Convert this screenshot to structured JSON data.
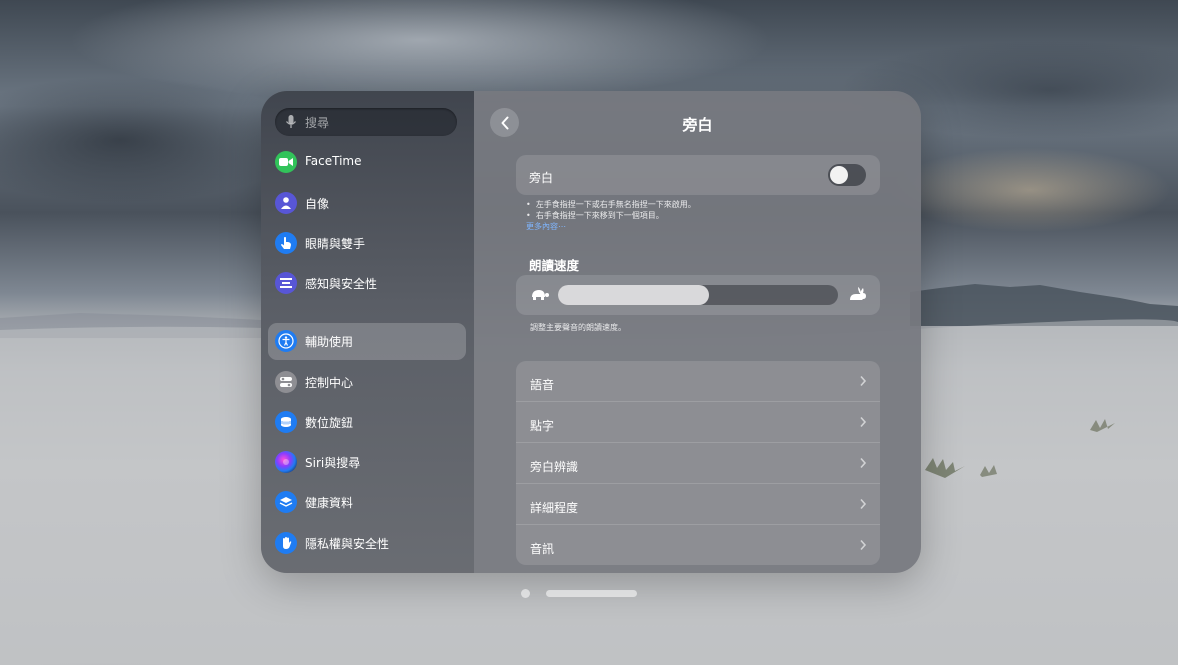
{
  "sidebar": {
    "search_placeholder": "搜尋",
    "items": [
      {
        "label": "FaceTime",
        "icon": "facetime-icon",
        "color": "#32c35a"
      },
      {
        "label": "自像",
        "icon": "persona-icon",
        "color": "#5856d6"
      },
      {
        "label": "眼睛與雙手",
        "icon": "hand-pointer-icon",
        "color": "#1f7cf2"
      },
      {
        "label": "感知與安全性",
        "icon": "awareness-icon",
        "color": "#5856d6"
      },
      {
        "label": "輔助使用",
        "icon": "accessibility-icon",
        "color": "#1f7cf2",
        "selected": true
      },
      {
        "label": "控制中心",
        "icon": "control-center-icon",
        "color": "#8e8e93"
      },
      {
        "label": "數位旋鈕",
        "icon": "digital-crown-icon",
        "color": "#1f7cf2"
      },
      {
        "label": "Siri與搜尋",
        "icon": "siri-icon",
        "color": "#2b2b5e"
      },
      {
        "label": "健康資料",
        "icon": "health-data-icon",
        "color": "#1f7cf2"
      },
      {
        "label": "隱私權與安全性",
        "icon": "hand-raised-icon",
        "color": "#1f7cf2"
      }
    ]
  },
  "main": {
    "title": "旁白",
    "toggle": {
      "label": "旁白",
      "on": false
    },
    "notes": [
      "左手食指捏一下或右手無名指捏一下來啟用。",
      "右手食指捏一下來移到下一個項目。"
    ],
    "more_link": "更多內容⋯",
    "speaking_rate": {
      "heading": "朗讀速度",
      "value": 0.54,
      "caption": "調整主要聲音的朗讀速度。"
    },
    "list": [
      "語音",
      "點字",
      "旁白辨識",
      "詳細程度",
      "音訊"
    ]
  },
  "pager": {
    "pages": 2,
    "current": 1
  }
}
